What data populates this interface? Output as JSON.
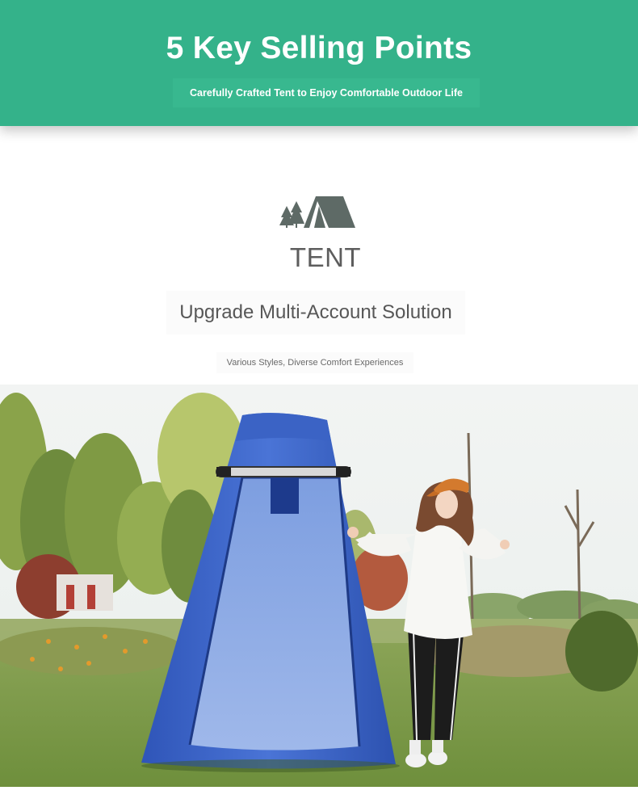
{
  "banner": {
    "title": "5 Key Selling Points",
    "subtitle": "Carefully Crafted Tent to Enjoy Comfortable Outdoor Life"
  },
  "section": {
    "icon": "tent-with-trees-icon",
    "category": "TENT",
    "headline": "Upgrade Multi-Account Solution",
    "tagline": "Various Styles, Diverse Comfort Experiences"
  },
  "photo": {
    "subject": "product-photo-popup-shower-tent"
  },
  "colors": {
    "banner_green": "#34b28a",
    "tent_blue": "#3a63c4",
    "icon_gray": "#5e6a66"
  }
}
